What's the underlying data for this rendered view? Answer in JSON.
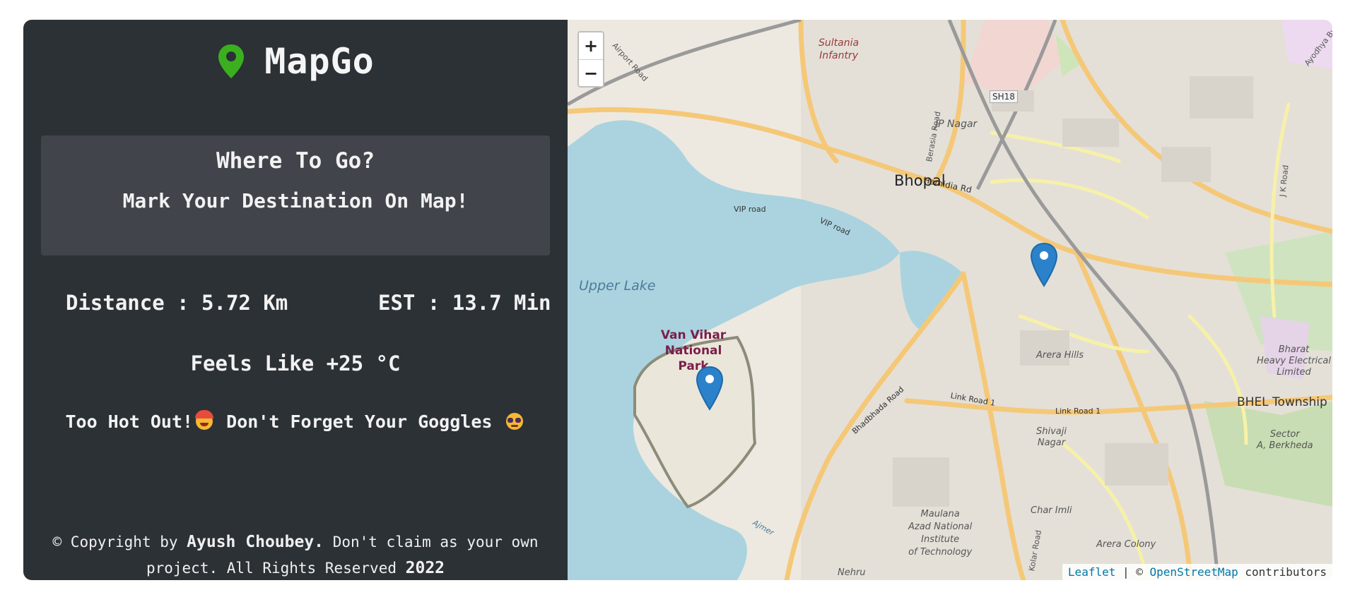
{
  "brand": {
    "name": "MapGo",
    "icon": "map-pin-icon",
    "icon_color": "#3bb01f"
  },
  "prompt": {
    "title": "Where To Go?",
    "subtitle": "Mark Your Destination On Map!"
  },
  "stats": {
    "distance": "Distance : 5.72 Km",
    "est": "EST : 13.7 Min"
  },
  "weather": {
    "feels_like": "Feels Like +25 °C",
    "advice_part1": "Too Hot Out!",
    "advice_part2": "Don't Forget Your Goggles",
    "icons": [
      "hot-face-icon",
      "sunglasses-face-icon"
    ]
  },
  "footer": {
    "prefix": "© Copyright by ",
    "author": "Ayush Choubey.",
    "middle": " Don't claim as your own project. All Rights Reserved ",
    "year": "2022"
  },
  "map": {
    "zoom_in": "+",
    "zoom_out": "−",
    "marker_color": "#2b82cb",
    "labels": {
      "city": "Bhopal",
      "lake": "Upper Lake",
      "park_line1": "Van Vihar",
      "park_line2": "National",
      "park_line3": "Park",
      "sultania_1": "Sultania",
      "sultania_2": "Infantry",
      "jp_nagar": "JP Nagar",
      "hamidia": "Hamidia Rd",
      "vip1": "VIP road",
      "vip2": "VIP road",
      "sh18": "SH18",
      "berasia": "Berasia Road",
      "airport": "Airport Road",
      "arera_hills": "Arera Hills",
      "link1a": "Link Road 1",
      "link1b": "Link Road 1",
      "bhadbhada": "Bhadbhada Road",
      "shivaji_1": "Shivaji",
      "shivaji_2": "Nagar",
      "bhel": "BHEL Township",
      "bharat_1": "Bharat",
      "bharat_2": "Heavy Electrical",
      "bharat_3": "Limited",
      "sector_1": "Sector",
      "sector_2": "A, Berkheda",
      "maulana_1": "Maulana",
      "maulana_2": "Azad National",
      "maulana_3": "Institute",
      "maulana_4": "of Technology",
      "char_imli": "Char Imli",
      "arera_colony": "Arera Colony",
      "kolar": "Kolar Road",
      "jk_road": "J K Road",
      "ayodhya": "Ayodhya Bypass",
      "nehru": "Nehru",
      "ajmer": "Ajmer"
    },
    "attribution": {
      "leaflet": "Leaflet",
      "sep": " | © ",
      "osm": "OpenStreetMap",
      "suffix": " contributors"
    }
  }
}
